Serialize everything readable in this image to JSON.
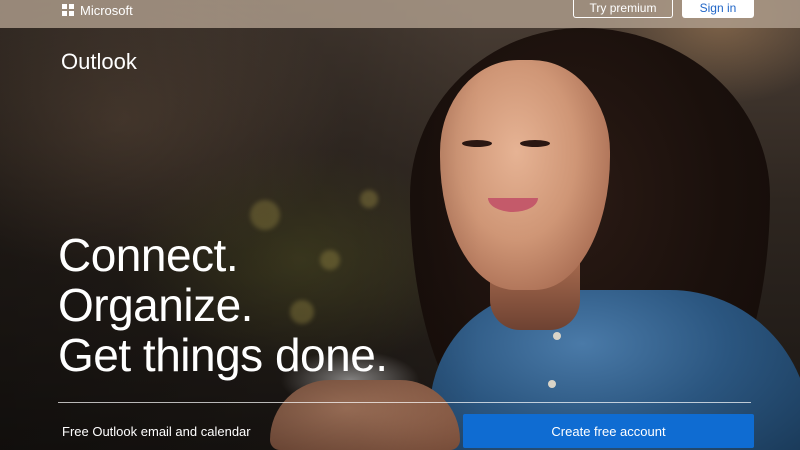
{
  "header": {
    "brand": "Microsoft",
    "try_premium_label": "Try premium",
    "sign_in_label": "Sign in"
  },
  "hero": {
    "product_name": "Outlook",
    "headline_lines": [
      "Connect.",
      "Organize.",
      "Get things done."
    ],
    "tagline": "Free Outlook email and calendar",
    "cta_label": "Create free account"
  },
  "colors": {
    "accent": "#0f6cd2",
    "sign_in_text": "#2166c7"
  }
}
